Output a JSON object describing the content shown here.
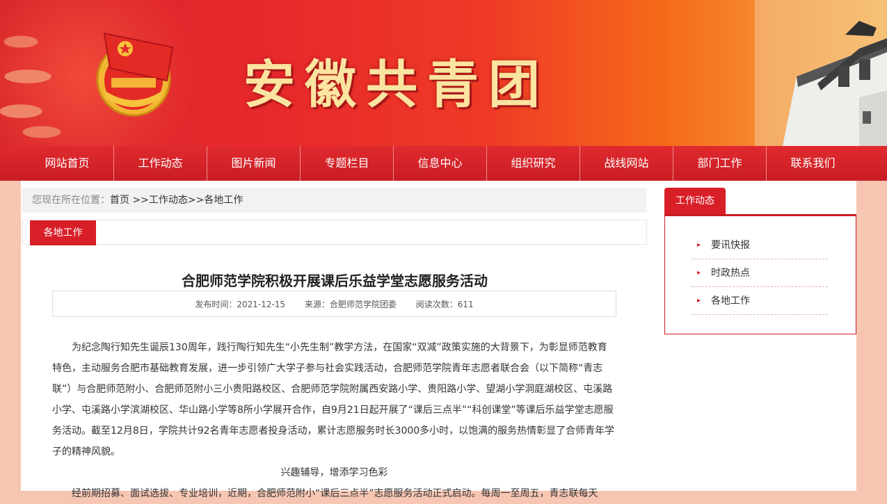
{
  "header": {
    "site_title": "安徽共青团",
    "emblem_icon": "youth-league-emblem-icon",
    "colors": {
      "primary": "#d81e27",
      "title": "#fbe4a0"
    }
  },
  "nav": {
    "items": [
      "网站首页",
      "工作动态",
      "图片新闻",
      "专题栏目",
      "信息中心",
      "组织研究",
      "战线网站",
      "部门工作",
      "联系我们"
    ]
  },
  "breadcrumb": {
    "prefix": "您现在所在位置：",
    "home": "首页",
    "sep1": " >>",
    "level1": "工作动态",
    "sep2": ">>",
    "level2": "各地工作"
  },
  "section_label": "各地工作",
  "article": {
    "title": "合肥师范学院积极开展课后乐益学堂志愿服务活动",
    "date": "发布时间：2021-12-15",
    "source": "来源：合肥师范学院团委",
    "views": "阅读次数：611",
    "paragraph1": "为纪念陶行知先生诞辰130周年，践行陶行知先生“小先生制”教学方法，在国家“双减”政策实施的大背景下，为彰显师范教育特色，主动服务合肥市基础教育发展，进一步引领广大学子参与社会实践活动，合肥师范学院青年志愿者联合会（以下简称“青志联”）与合肥师范附小、合肥师范附小三小贵阳路校区、合肥师范学院附属西安路小学、贵阳路小学、望湖小学洞庭湖校区、屯溪路小学、屯溪路小学滨湖校区、华山路小学等8所小学展开合作，自9月21日起开展了“课后三点半”“科创课堂”等课后乐益学堂志愿服务活动。截至12月8日，学院共计92名青年志愿者投身活动，累计志愿服务时长3000多小时，以饱满的服务热情彰显了合师青年学子的精神风貌。",
    "subheading": "兴趣辅导，增添学习色彩",
    "paragraph2": "经前期招募、面试选拔、专业培训，近期，合肥师范附小“课后三点半”志愿服务活动正式启动。每周一至周五，青志联每天"
  },
  "sidebar": {
    "tab": "工作动态",
    "items": [
      "要讯快报",
      "时政热点",
      "各地工作"
    ]
  }
}
